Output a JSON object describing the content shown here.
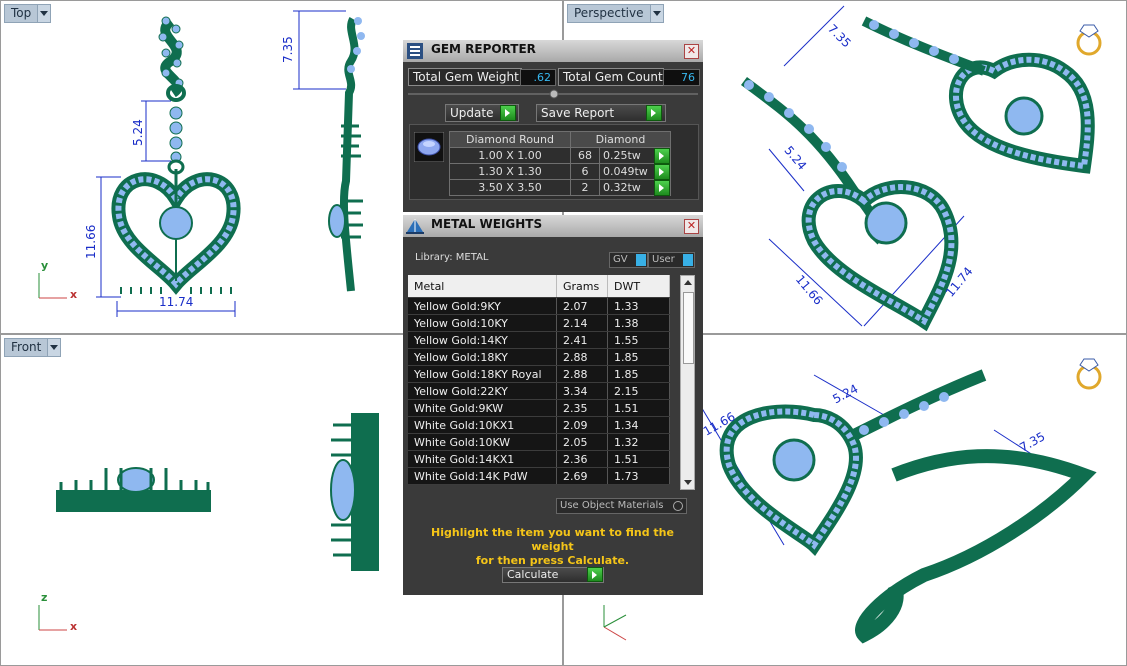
{
  "viewports": {
    "top": {
      "label": "Top",
      "dims": {
        "top": "7.35",
        "pendant": "5.24",
        "height": "11.66",
        "width": "11.74"
      },
      "axes": {
        "v": "y",
        "h": "x"
      }
    },
    "perspective": {
      "label": "Perspective",
      "dims": {
        "a": "7.35",
        "b": "5.24",
        "c": "11.66",
        "d": "11.74"
      }
    },
    "front": {
      "label": "Front",
      "axes": {
        "v": "z",
        "h": "x"
      }
    },
    "iso": {
      "dims": {
        "a": "11.66",
        "b": "5.24",
        "c": "7.35"
      }
    }
  },
  "gem_reporter": {
    "title": "GEM REPORTER",
    "total_weight_label": "Total Gem Weight",
    "total_weight_value": ".62",
    "total_count_label": "Total Gem Count",
    "total_count_value": "76",
    "update_label": "Update",
    "save_report_label": "Save Report",
    "table_header": {
      "shape": "Diamond Round",
      "type": "Diamond"
    },
    "rows": [
      {
        "size": "1.00 X 1.00",
        "count": "68",
        "tw": "0.25tw"
      },
      {
        "size": "1.30 X 1.30",
        "count": "6",
        "tw": "0.049tw"
      },
      {
        "size": "3.50 X 3.50",
        "count": "2",
        "tw": "0.32tw"
      }
    ]
  },
  "metal_weights": {
    "title": "METAL WEIGHTS",
    "library_label": "Library: METAL",
    "gv_label": "GV",
    "user_label": "User",
    "columns": [
      "Metal",
      "Grams",
      "DWT"
    ],
    "rows": [
      {
        "metal": "Yellow Gold:9KY",
        "grams": "2.07",
        "dwt": "1.33"
      },
      {
        "metal": "Yellow Gold:10KY",
        "grams": "2.14",
        "dwt": "1.38"
      },
      {
        "metal": "Yellow Gold:14KY",
        "grams": "2.41",
        "dwt": "1.55"
      },
      {
        "metal": "Yellow Gold:18KY",
        "grams": "2.88",
        "dwt": "1.85"
      },
      {
        "metal": "Yellow Gold:18KY Royal",
        "grams": "2.88",
        "dwt": "1.85"
      },
      {
        "metal": "Yellow Gold:22KY",
        "grams": "3.34",
        "dwt": "2.15"
      },
      {
        "metal": "White Gold:9KW",
        "grams": "2.35",
        "dwt": "1.51"
      },
      {
        "metal": "White Gold:10KX1",
        "grams": "2.09",
        "dwt": "1.34"
      },
      {
        "metal": "White Gold:10KW",
        "grams": "2.05",
        "dwt": "1.32"
      },
      {
        "metal": "White Gold:14KX1",
        "grams": "2.36",
        "dwt": "1.51"
      },
      {
        "metal": "White Gold:14K PdW",
        "grams": "2.69",
        "dwt": "1.73"
      }
    ],
    "use_object_materials_label": "Use Object Materials",
    "hint_line1": "Highlight the item you want to find the weight",
    "hint_line2": "for then press Calculate.",
    "calculate_label": "Calculate"
  },
  "colors": {
    "metal": "#0f6e4f",
    "gem": "#8fb8f0",
    "dimension": "#1a2ec8",
    "panel_bg": "#3a3a3a",
    "accent_green": "#2eae2e"
  }
}
